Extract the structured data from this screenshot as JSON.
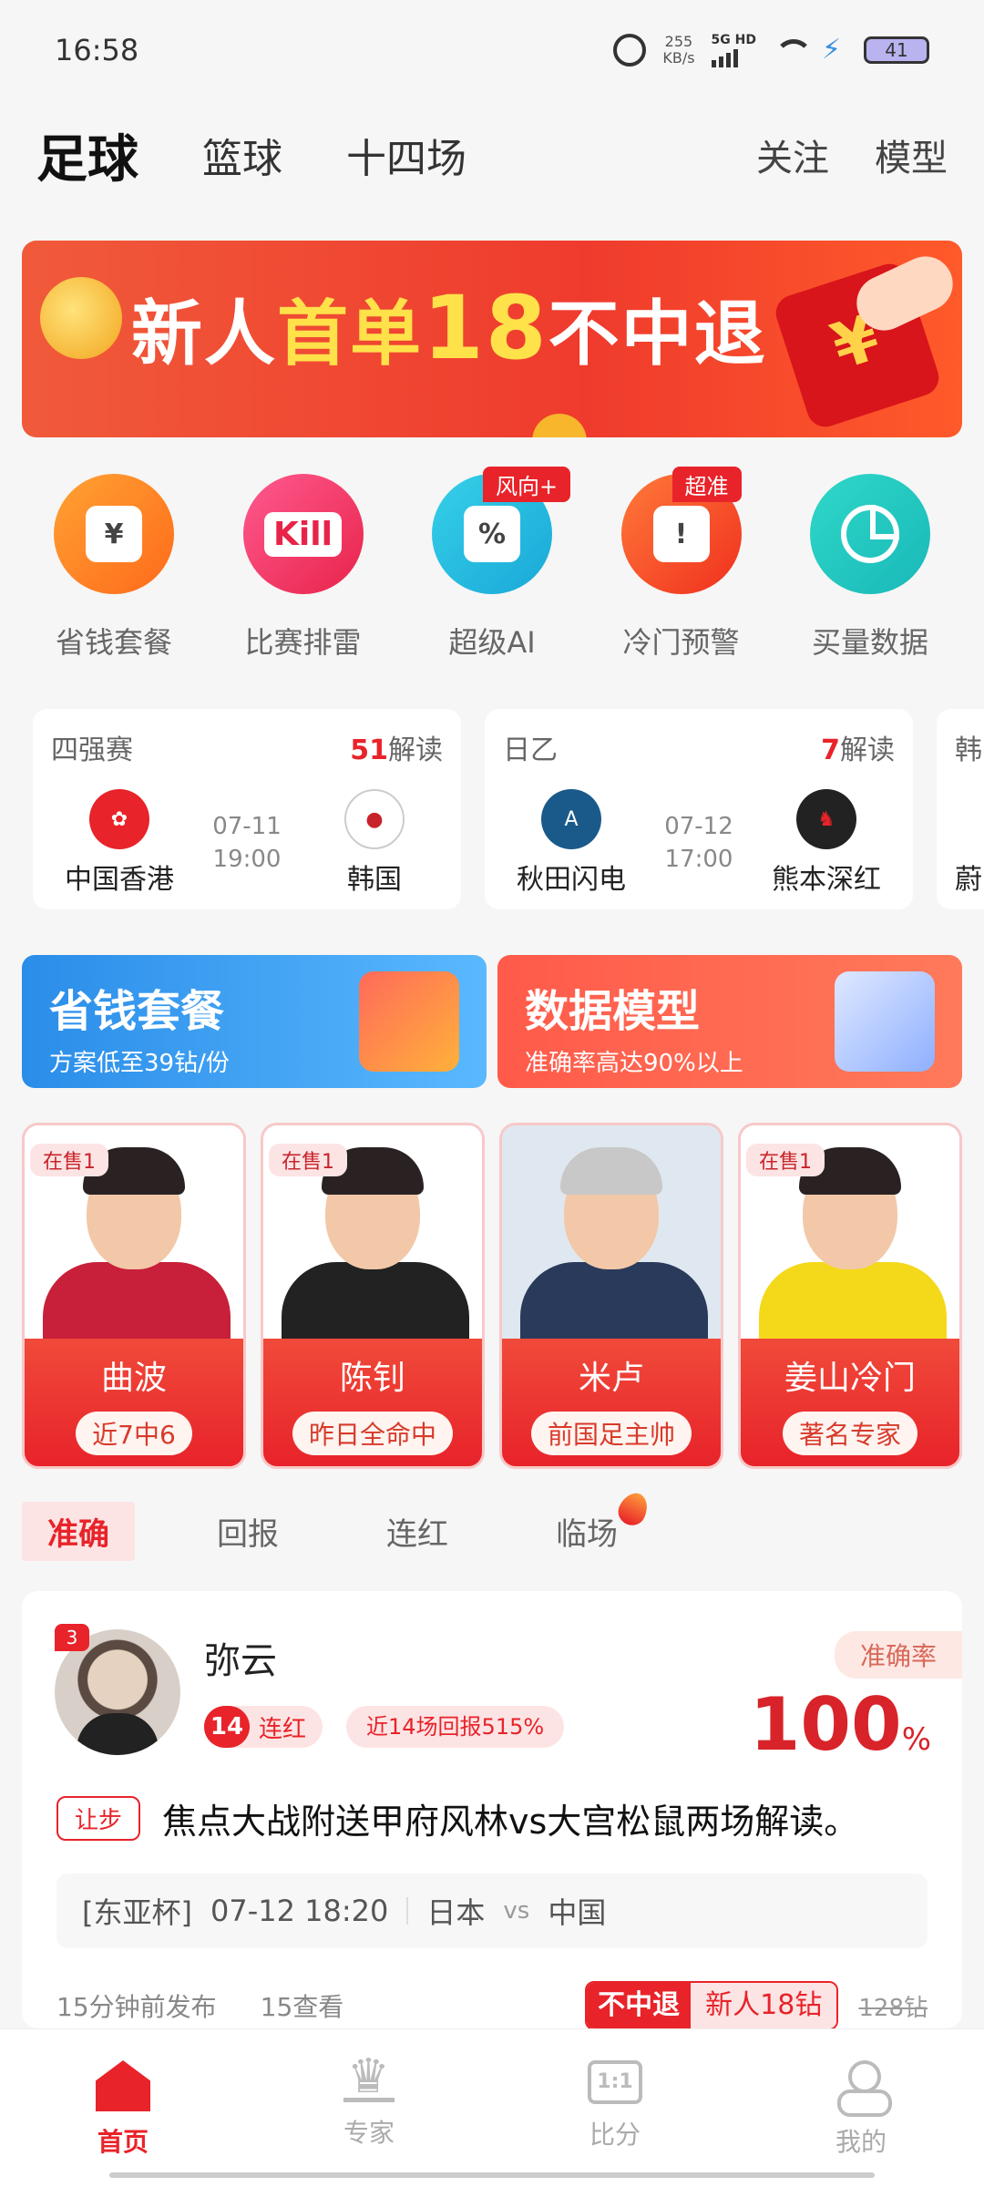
{
  "status_bar": {
    "time": "16:58",
    "net_speed": "255",
    "net_speed_unit": "KB/s",
    "signal_label": "5G HD",
    "battery": "41"
  },
  "top_nav": {
    "tabs": [
      "足球",
      "篮球",
      "十四场"
    ],
    "right_tabs": [
      "关注",
      "模型"
    ]
  },
  "banner": {
    "prefix": "新人",
    "highlight": "首单",
    "number": "18",
    "suffix": "不中退"
  },
  "quick_actions": [
    {
      "label": "省钱套餐",
      "icon": "money-bag-icon",
      "badge": ""
    },
    {
      "label": "比赛排雷",
      "icon": "kill-icon",
      "badge": ""
    },
    {
      "label": "超级AI",
      "icon": "ai-screen-icon",
      "badge": "风向+"
    },
    {
      "label": "冷门预警",
      "icon": "alarm-icon",
      "badge": "超准"
    },
    {
      "label": "买量数据",
      "icon": "pie-chart-icon",
      "badge": ""
    }
  ],
  "matches": [
    {
      "league": "四强赛",
      "count": "51",
      "count_suffix": "解读",
      "home": "中国香港",
      "away": "韩国",
      "date": "07-11",
      "time": "19:00"
    },
    {
      "league": "日乙",
      "count": "7",
      "count_suffix": "解读",
      "home": "秋田闪电",
      "away": "熊本深红",
      "date": "07-12",
      "time": "17:00"
    },
    {
      "league": "韩",
      "count": "",
      "count_suffix": "",
      "home": "蔚",
      "away": "",
      "date": "",
      "time": ""
    }
  ],
  "promos": [
    {
      "title": "省钱套餐",
      "subtitle": "方案低至39钻/份"
    },
    {
      "title": "数据模型",
      "subtitle": "准确率高达90%以上"
    }
  ],
  "experts": [
    {
      "on_sale": "在售1",
      "name": "曲波",
      "tag": "近7中6"
    },
    {
      "on_sale": "在售1",
      "name": "陈钊",
      "tag": "昨日全命中"
    },
    {
      "on_sale": "",
      "name": "米卢",
      "tag": "前国足主帅"
    },
    {
      "on_sale": "在售1",
      "name": "姜山冷门",
      "tag": "著名专家"
    }
  ],
  "sort_tabs": [
    "准确",
    "回报",
    "连红",
    "临场"
  ],
  "post": {
    "rank": "3",
    "author": "弥云",
    "streak_num": "14",
    "streak_label": "连红",
    "return_label": "近14场回报515%",
    "accuracy_label": "准确率",
    "accuracy_value": "100",
    "accuracy_unit": "%",
    "tag": "让步",
    "title": "焦点大战附送甲府风林vs大宫松鼠两场解读。",
    "match_league": "[东亚杯]",
    "match_time": "07-12 18:20",
    "home": "日本",
    "vs": "vs",
    "away": "中国",
    "published": "15分钟前发布",
    "views": "15查看",
    "refund_label": "不中退",
    "price_label": "新人18钻",
    "old_price": "128钻"
  },
  "bottom_nav": [
    {
      "label": "首页",
      "icon": "home-icon"
    },
    {
      "label": "专家",
      "icon": "crown-icon"
    },
    {
      "label": "比分",
      "icon": "scoreboard-icon"
    },
    {
      "label": "我的",
      "icon": "profile-icon"
    }
  ],
  "colors": {
    "accent": "#e8232a",
    "background": "#f6f6f6"
  }
}
